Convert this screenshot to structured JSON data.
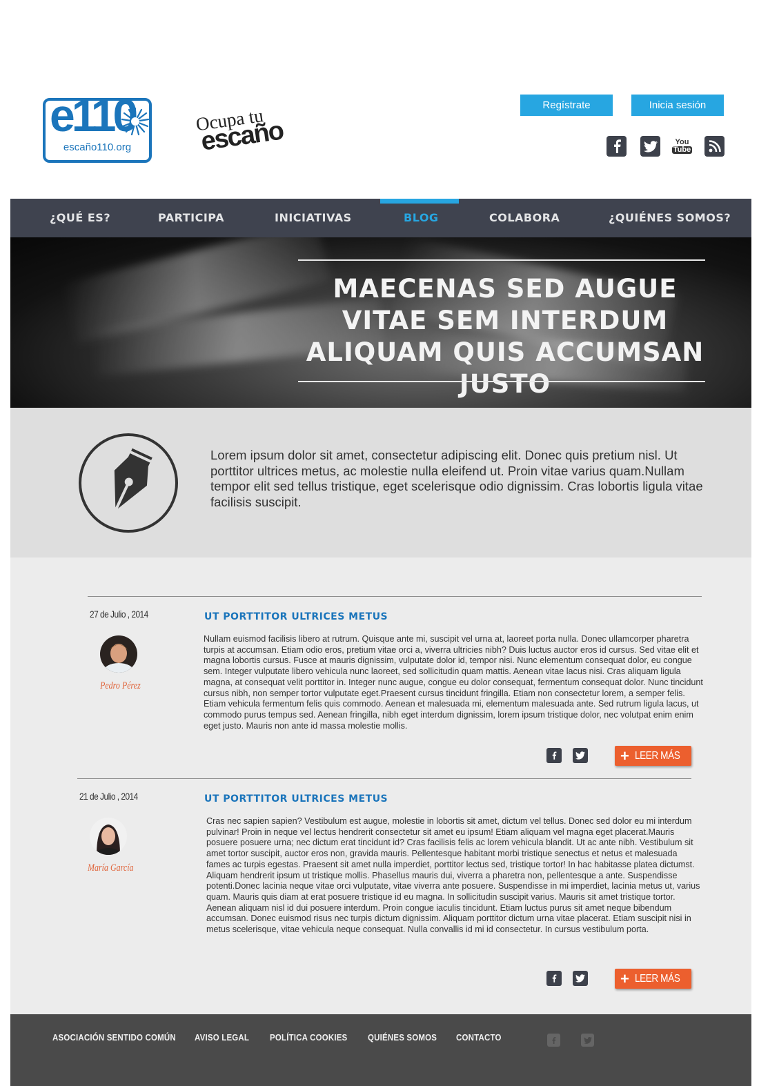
{
  "header": {
    "logo_text": "e110",
    "logo_url_text": "escaño110.org",
    "ocupa_line1": "Ocupa tu",
    "ocupa_line2": "escaño",
    "register_label": "Regístrate",
    "login_label": "Inicia sesión",
    "social": [
      "facebook-icon",
      "twitter-icon",
      "youtube-icon",
      "rss-icon"
    ],
    "youtube_top": "You",
    "youtube_bottom": "Tube"
  },
  "nav": {
    "items": [
      {
        "label": "¿QUÉ ES?"
      },
      {
        "label": "PARTICIPA"
      },
      {
        "label": "INICIATIVAS"
      },
      {
        "label": "BLOG"
      },
      {
        "label": "COLABORA"
      },
      {
        "label": "¿QUIÉNES SOMOS?"
      }
    ],
    "active": "BLOG"
  },
  "hero": {
    "title": "MAECENAS SED AUGUE VITAE SEM INTERDUM ALIQUAM QUIS ACCUMSAN JUSTO"
  },
  "intro": {
    "icon": "pen-nib-icon",
    "text": "Lorem ipsum dolor sit amet, consectetur adipiscing elit. Donec quis pretium nisl. Ut porttitor ultrices metus, ac molestie nulla eleifend ut. Proin vitae varius quam.Nullam tempor elit sed tellus tristique, eget scelerisque odio dignissim. Cras lobortis ligula vitae facilisis suscipit."
  },
  "posts": [
    {
      "date": "27 de Julio , 2014",
      "author": "Pedro Pérez",
      "title": "UT PORTTITOR ULTRICES METUS",
      "body": "Nullam euismod facilisis libero at rutrum. Quisque ante mi, suscipit vel urna at, laoreet porta nulla. Donec ullamcorper pharetra turpis at accumsan. Etiam odio eros, pretium vitae orci a, viverra ultricies nibh? Duis luctus auctor eros id cursus. Sed vitae elit et magna lobortis cursus. Fusce at mauris dignissim, vulputate dolor id, tempor nisi. Nunc elementum consequat dolor, eu congue sem. Integer vulputate libero vehicula nunc laoreet, sed sollicitudin quam mattis. Aenean vitae lacus nisi. Cras aliquam ligula magna, at consequat velit porttitor in. Integer nunc augue, congue eu dolor consequat, fermentum consequat dolor. Nunc tincidunt cursus nibh, non semper tortor vulputate eget.Praesent cursus tincidunt fringilla. Etiam non consectetur lorem, a semper felis. Etiam vehicula fermentum felis quis commodo. Aenean et malesuada mi, elementum malesuada ante. Sed rutrum ligula lacus, ut commodo purus tempus sed. Aenean fringilla, nibh eget interdum dignissim, lorem ipsum tristique dolor, nec volutpat enim enim eget justo. Mauris non ante id massa molestie mollis.",
      "read_more": "LEER MÁS"
    },
    {
      "date": "21 de Julio , 2014",
      "author": "María García",
      "title": "UT PORTTITOR ULTRICES METUS",
      "body": "Cras nec sapien sapien? Vestibulum est augue, molestie in lobortis sit amet, dictum vel tellus. Donec sed dolor eu mi interdum pulvinar! Proin in neque vel lectus hendrerit consectetur sit amet eu ipsum! Etiam aliquam vel magna eget placerat.Mauris posuere posuere urna; nec dictum erat tincidunt id? Cras facilisis felis ac lorem vehicula blandit. Ut ac ante nibh. Vestibulum sit amet tortor suscipit, auctor eros non, gravida mauris. Pellentesque habitant morbi tristique senectus et netus et malesuada fames ac turpis egestas. Praesent sit amet nulla imperdiet, porttitor lectus sed, tristique tortor! In hac habitasse platea dictumst. Aliquam hendrerit ipsum ut tristique mollis. Phasellus mauris dui, viverra a pharetra non, pellentesque a ante. Suspendisse potenti.Donec lacinia neque vitae orci vulputate, vitae viverra ante posuere. Suspendisse in mi imperdiet, lacinia metus ut, varius quam. Mauris quis diam at erat posuere tristique id eu magna. In sollicitudin suscipit varius. Mauris sit amet tristique tortor. Aenean aliquam nisl id dui posuere interdum. Proin congue iaculis tincidunt. Etiam luctus purus sit amet neque bibendum accumsan. Donec euismod risus nec turpis dictum dignissim. Aliquam porttitor dictum urna vitae placerat. Etiam suscipit nisi in metus scelerisque, vitae vehicula neque consequat. Nulla convallis id mi id consectetur. In cursus vestibulum porta.",
      "read_more": "LEER MÁS"
    }
  ],
  "footer": {
    "links": [
      {
        "label": "ASOCIACIÓN SENTIDO COMÚN"
      },
      {
        "label": "AVISO LEGAL"
      },
      {
        "label": "POLÍTICA COOKIES"
      },
      {
        "label": "QUIÉNES SOMOS"
      },
      {
        "label": "CONTACTO"
      }
    ],
    "social": [
      "facebook-icon",
      "twitter-icon"
    ]
  },
  "colors": {
    "accent_blue": "#27a6e1",
    "brand_blue": "#1b75bb",
    "nav_bg": "#3f434f",
    "orange": "#ec5f2e",
    "footer_bg": "#4a4a4a"
  }
}
